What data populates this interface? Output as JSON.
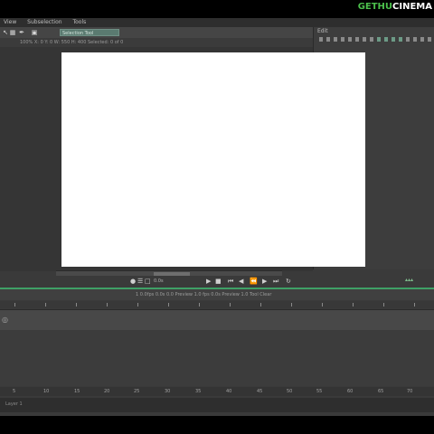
{
  "watermark": {
    "part1": "GETHU",
    "part2": "CINEMA"
  },
  "menubar": {
    "items": [
      "View",
      "Subselection",
      "Tools"
    ]
  },
  "toolbar": {
    "icons": [
      "arrow-icon",
      "subselect-icon",
      "lasso-icon",
      "save-icon"
    ],
    "dropdown_value": "Selection Tool"
  },
  "infobar": {
    "text": "100%  X: 0  Y: 0  W: 550  H: 400  Selected: 0 of 0"
  },
  "right_panel": {
    "title": "Edit"
  },
  "transport": {
    "readout": "0.0s"
  },
  "timeline": {
    "header_text": "1  0.0fps  0.0s  0.0  Preview  1.0 fps  0.0s  Preview  1.0  Tool  Clear"
  },
  "frame_numbers": [
    "5",
    "10",
    "15",
    "20",
    "25",
    "30",
    "35",
    "40",
    "45",
    "50",
    "55",
    "60",
    "65",
    "70"
  ],
  "statusbar": {
    "text": "Layer 1"
  }
}
